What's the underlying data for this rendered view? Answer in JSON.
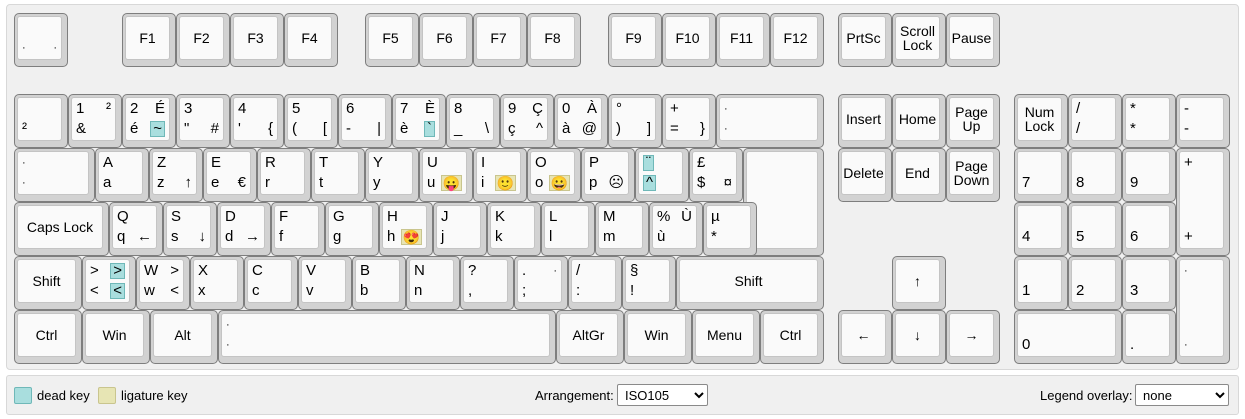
{
  "keyboard": {
    "keys": [
      {
        "id": "backquote",
        "label": "",
        "legends": [
          "²",
          "",
          "",
          ""
        ],
        "dead": []
      },
      {
        "id": "escape",
        "label": "",
        "legends": [
          "·",
          "",
          "·",
          ""
        ],
        "dead": []
      },
      {
        "id": "f1",
        "label": "F1"
      },
      {
        "id": "f2",
        "label": "F2"
      },
      {
        "id": "f3",
        "label": "F3"
      },
      {
        "id": "f4",
        "label": "F4"
      },
      {
        "id": "f5",
        "label": "F5"
      },
      {
        "id": "f6",
        "label": "F6"
      },
      {
        "id": "f7",
        "label": "F7"
      },
      {
        "id": "f8",
        "label": "F8"
      },
      {
        "id": "f9",
        "label": "F9"
      },
      {
        "id": "f10",
        "label": "F10"
      },
      {
        "id": "f11",
        "label": "F11"
      },
      {
        "id": "f12",
        "label": "F12"
      },
      {
        "id": "prtsc",
        "label": "PrtSc"
      },
      {
        "id": "scrolllock",
        "label": "Scroll\nLock"
      },
      {
        "id": "pause",
        "label": "Pause"
      },
      {
        "id": "digit1",
        "legends": [
          "&",
          "1",
          "",
          "²"
        ]
      },
      {
        "id": "digit2",
        "legends": [
          "é",
          "2",
          "~",
          "É"
        ],
        "dead": [
          2
        ]
      },
      {
        "id": "digit3",
        "legends": [
          "\"",
          "3",
          "#",
          ""
        ]
      },
      {
        "id": "digit4",
        "legends": [
          "'",
          "4",
          "{",
          ""
        ]
      },
      {
        "id": "digit5",
        "legends": [
          "(",
          "5",
          "[",
          ""
        ]
      },
      {
        "id": "digit6",
        "legends": [
          "-",
          "6",
          "|",
          ""
        ]
      },
      {
        "id": "digit7",
        "legends": [
          "è",
          "7",
          "`",
          "È"
        ],
        "dead": [
          2
        ]
      },
      {
        "id": "digit8",
        "legends": [
          "_",
          "8",
          "\\",
          ""
        ]
      },
      {
        "id": "digit9",
        "legends": [
          "ç",
          "9",
          "^",
          "Ç"
        ]
      },
      {
        "id": "digit0",
        "legends": [
          "à",
          "0",
          "@",
          "À"
        ]
      },
      {
        "id": "minus",
        "legends": [
          ")",
          "°",
          "]",
          ""
        ]
      },
      {
        "id": "equal",
        "legends": [
          "=",
          "+",
          "}",
          ""
        ]
      },
      {
        "id": "backspace",
        "legends": [
          "·",
          "·",
          "",
          ""
        ]
      },
      {
        "id": "tab",
        "legends": [
          "·",
          "·",
          "",
          ""
        ]
      },
      {
        "id": "keyq",
        "legends": [
          "a",
          "A",
          "",
          ""
        ]
      },
      {
        "id": "keyw",
        "legends": [
          "z",
          "Z",
          "↑",
          ""
        ]
      },
      {
        "id": "keye",
        "legends": [
          "e",
          "E",
          "€",
          ""
        ]
      },
      {
        "id": "keyr",
        "legends": [
          "r",
          "R",
          "",
          ""
        ]
      },
      {
        "id": "keyt",
        "legends": [
          "t",
          "T",
          "",
          ""
        ]
      },
      {
        "id": "keyy",
        "legends": [
          "y",
          "Y",
          "",
          ""
        ]
      },
      {
        "id": "keyu",
        "legends": [
          "u",
          "U",
          "😛",
          ""
        ],
        "lig": [
          2
        ]
      },
      {
        "id": "keyi",
        "legends": [
          "i",
          "I",
          "🙂",
          ""
        ],
        "lig": [
          2
        ]
      },
      {
        "id": "keyo",
        "legends": [
          "o",
          "O",
          "😀",
          ""
        ],
        "lig": [
          2
        ]
      },
      {
        "id": "keyp",
        "legends": [
          "p",
          "P",
          "☹",
          ""
        ]
      },
      {
        "id": "bracketleft",
        "legends": [
          "^",
          "¨",
          "",
          ""
        ],
        "dead": [
          0,
          1
        ]
      },
      {
        "id": "bracketright",
        "legends": [
          "$",
          "£",
          "¤",
          ""
        ]
      },
      {
        "id": "enter",
        "legends": [
          "·",
          "",
          "",
          ""
        ]
      },
      {
        "id": "capslock",
        "label": "Caps Lock"
      },
      {
        "id": "keya",
        "legends": [
          "q",
          "Q",
          "←",
          ""
        ]
      },
      {
        "id": "keys",
        "legends": [
          "s",
          "S",
          "↓",
          ""
        ]
      },
      {
        "id": "keyd",
        "legends": [
          "d",
          "D",
          "→",
          ""
        ]
      },
      {
        "id": "keyf",
        "legends": [
          "f",
          "F",
          "",
          ""
        ]
      },
      {
        "id": "keyg",
        "legends": [
          "g",
          "G",
          "",
          ""
        ]
      },
      {
        "id": "keyh",
        "legends": [
          "h",
          "H",
          "😍",
          ""
        ],
        "lig": [
          2
        ]
      },
      {
        "id": "keyj",
        "legends": [
          "j",
          "J",
          "",
          ""
        ]
      },
      {
        "id": "keyk",
        "legends": [
          "k",
          "K",
          "",
          ""
        ]
      },
      {
        "id": "keyl",
        "legends": [
          "l",
          "L",
          "",
          ""
        ]
      },
      {
        "id": "semicolon",
        "legends": [
          "m",
          "M",
          "",
          ""
        ]
      },
      {
        "id": "quote",
        "legends": [
          "ù",
          "%",
          "",
          "Ù"
        ]
      },
      {
        "id": "backslash",
        "legends": [
          "*",
          "µ",
          "",
          ""
        ]
      },
      {
        "id": "shiftleft",
        "label": "Shift"
      },
      {
        "id": "intlbackslash",
        "legends": [
          "<",
          ">",
          "<",
          ">"
        ],
        "dead": [
          2,
          3
        ]
      },
      {
        "id": "keyz",
        "legends": [
          "w",
          "W",
          "<",
          ">"
        ]
      },
      {
        "id": "keyx",
        "legends": [
          "x",
          "X",
          "",
          ""
        ]
      },
      {
        "id": "keyc",
        "legends": [
          "c",
          "C",
          "",
          ""
        ]
      },
      {
        "id": "keyv",
        "legends": [
          "v",
          "V",
          "",
          ""
        ]
      },
      {
        "id": "keyb",
        "legends": [
          "b",
          "B",
          "",
          ""
        ]
      },
      {
        "id": "keyn",
        "legends": [
          "n",
          "N",
          "",
          ""
        ]
      },
      {
        "id": "keym",
        "legends": [
          ",",
          "?",
          "",
          ""
        ]
      },
      {
        "id": "comma",
        "legends": [
          ";",
          ".",
          "",
          "·"
        ]
      },
      {
        "id": "period",
        "legends": [
          ":",
          "/",
          "",
          ""
        ]
      },
      {
        "id": "slash",
        "legends": [
          "!",
          "§",
          "",
          ""
        ]
      },
      {
        "id": "shiftright",
        "label": "Shift"
      },
      {
        "id": "controlleft",
        "label": "Ctrl"
      },
      {
        "id": "metaleft",
        "label": "Win"
      },
      {
        "id": "altleft",
        "label": "Alt"
      },
      {
        "id": "space",
        "legends": [
          "·",
          "·",
          "",
          ""
        ]
      },
      {
        "id": "altright",
        "label": "AltGr"
      },
      {
        "id": "metaright",
        "label": "Win"
      },
      {
        "id": "contextmenu",
        "label": "Menu"
      },
      {
        "id": "controlright",
        "label": "Ctrl"
      },
      {
        "id": "insert",
        "label": "Insert"
      },
      {
        "id": "home",
        "label": "Home"
      },
      {
        "id": "pageup",
        "label": "Page\nUp"
      },
      {
        "id": "delete",
        "label": "Delete"
      },
      {
        "id": "end",
        "label": "End"
      },
      {
        "id": "pagedown",
        "label": "Page\nDown"
      },
      {
        "id": "arrowup",
        "label": "↑"
      },
      {
        "id": "arrowleft",
        "label": "←"
      },
      {
        "id": "arrowdown",
        "label": "↓"
      },
      {
        "id": "arrowright",
        "label": "→"
      },
      {
        "id": "numlock",
        "label": "Num\nLock"
      },
      {
        "id": "numpaddivide",
        "legends": [
          "/",
          "/",
          "",
          ""
        ]
      },
      {
        "id": "numpadmultiply",
        "legends": [
          "*",
          "*",
          "",
          ""
        ]
      },
      {
        "id": "numpadsubtract",
        "legends": [
          "-",
          "-",
          "",
          ""
        ]
      },
      {
        "id": "numpad7",
        "legends": [
          "7",
          "",
          "",
          ""
        ]
      },
      {
        "id": "numpad8",
        "legends": [
          "8",
          "",
          "",
          ""
        ]
      },
      {
        "id": "numpad9",
        "legends": [
          "9",
          "",
          "",
          ""
        ]
      },
      {
        "id": "numpadadd",
        "legends": [
          "+",
          "+",
          "",
          ""
        ]
      },
      {
        "id": "numpad4",
        "legends": [
          "4",
          "",
          "",
          ""
        ]
      },
      {
        "id": "numpad5",
        "legends": [
          "5",
          "",
          "",
          ""
        ]
      },
      {
        "id": "numpad6",
        "legends": [
          "6",
          "",
          "",
          ""
        ]
      },
      {
        "id": "numpad1",
        "legends": [
          "1",
          "",
          "",
          ""
        ]
      },
      {
        "id": "numpad2",
        "legends": [
          "2",
          "",
          "",
          ""
        ]
      },
      {
        "id": "numpad3",
        "legends": [
          "3",
          "",
          "",
          ""
        ]
      },
      {
        "id": "numpadenter",
        "legends": [
          "·",
          "·",
          "",
          ""
        ]
      },
      {
        "id": "numpad0",
        "legends": [
          "0",
          "",
          "",
          ""
        ]
      },
      {
        "id": "numpaddecimal",
        "legends": [
          ".",
          "",
          "",
          ""
        ]
      }
    ]
  },
  "footer": {
    "dead_key_label": "dead key",
    "ligature_key_label": "ligature key",
    "arrangement_label": "Arrangement:",
    "arrangement_value": "ISO105",
    "legend_overlay_label": "Legend overlay:",
    "legend_overlay_value": "none"
  },
  "colors": {
    "dead_key": "#a9dede",
    "ligature_key": "#e7e5b4"
  }
}
